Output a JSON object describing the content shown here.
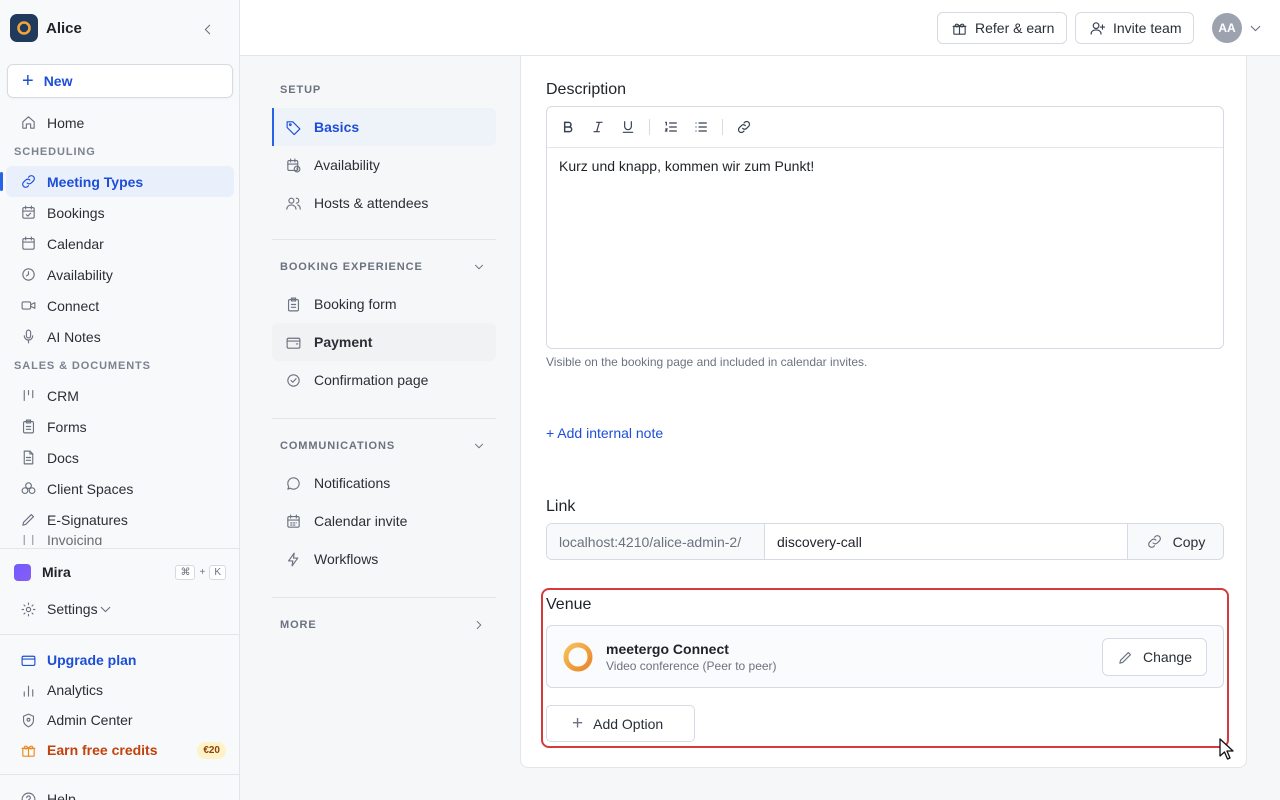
{
  "workspace": {
    "name": "Alice"
  },
  "sidebar": {
    "new_label": "New",
    "home": "Home",
    "section_scheduling": "SCHEDULING",
    "scheduling": [
      {
        "label": "Meeting Types",
        "icon": "link-icon",
        "active": true
      },
      {
        "label": "Bookings",
        "icon": "calendar-check-icon"
      },
      {
        "label": "Calendar",
        "icon": "calendar-icon"
      },
      {
        "label": "Availability",
        "icon": "clock-icon"
      },
      {
        "label": "Connect",
        "icon": "video-icon"
      },
      {
        "label": "AI Notes",
        "icon": "mic-icon"
      }
    ],
    "section_sales": "SALES & DOCUMENTS",
    "sales": [
      {
        "label": "CRM",
        "icon": "pipeline-icon"
      },
      {
        "label": "Forms",
        "icon": "clipboard-icon"
      },
      {
        "label": "Docs",
        "icon": "document-icon"
      },
      {
        "label": "Client Spaces",
        "icon": "spaces-icon"
      },
      {
        "label": "E-Signatures",
        "icon": "pen-icon"
      },
      {
        "label": "Invoicing",
        "icon": "invoice-icon"
      }
    ],
    "mira": {
      "label": "Mira",
      "shortcut_mod": "⌘",
      "shortcut_plus": "+",
      "shortcut_key": "K"
    },
    "settings": "Settings",
    "upgrade": "Upgrade plan",
    "analytics": "Analytics",
    "admin": "Admin Center",
    "earn": "Earn free credits",
    "earn_badge": "€20",
    "help": "Help"
  },
  "topbar": {
    "refer": "Refer & earn",
    "invite": "Invite team",
    "avatar": "AA"
  },
  "subnav": {
    "setup": "SETUP",
    "setup_items": [
      {
        "label": "Basics",
        "icon": "tag-icon",
        "active": true
      },
      {
        "label": "Availability",
        "icon": "calendar-clock-icon"
      },
      {
        "label": "Hosts & attendees",
        "icon": "users-icon"
      }
    ],
    "booking_experience": "BOOKING EXPERIENCE",
    "booking_items": [
      {
        "label": "Booking form",
        "icon": "clipboard-icon"
      },
      {
        "label": "Payment",
        "icon": "wallet-icon",
        "hover": true
      },
      {
        "label": "Confirmation page",
        "icon": "check-circle-icon"
      }
    ],
    "communications": "COMMUNICATIONS",
    "comm_items": [
      {
        "label": "Notifications",
        "icon": "chat-icon"
      },
      {
        "label": "Calendar invite",
        "icon": "calendar-icon"
      },
      {
        "label": "Workflows",
        "icon": "bolt-icon"
      }
    ],
    "more": "MORE"
  },
  "main": {
    "description_label": "Description",
    "description_text": "Kurz und knapp, kommen wir zum Punkt!",
    "description_hint": "Visible on the booking page and included in calendar invites.",
    "add_internal_note": "+ Add internal note",
    "link_label": "Link",
    "link_prefix": "localhost:4210/alice-admin-2/",
    "link_slug": "discovery-call",
    "copy_label": "Copy",
    "venue_label": "Venue",
    "venue_title": "meetergo Connect",
    "venue_sub": "Video conference (Peer to peer)",
    "change_label": "Change",
    "add_option_label": "Add Option"
  },
  "colors": {
    "accent": "#2563eb",
    "highlight_border": "#d63b3b",
    "earn": "#c2410c"
  }
}
